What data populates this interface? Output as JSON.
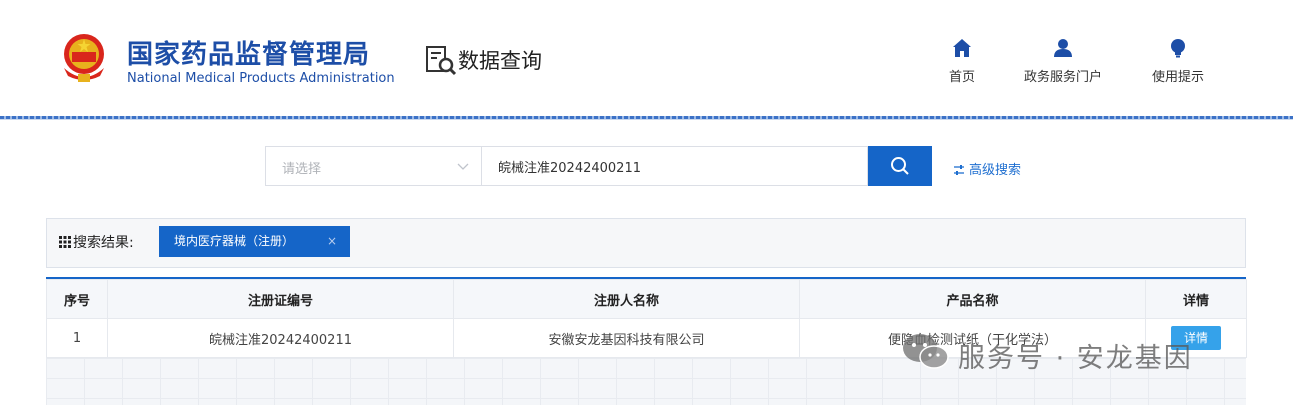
{
  "header": {
    "agency_cn": "国家药品监督管理局",
    "agency_en": "National Medical Products Administration",
    "section": "数据查询",
    "nav": [
      {
        "label": "首页",
        "icon": "home-icon"
      },
      {
        "label": "政务服务门户",
        "icon": "user-icon"
      },
      {
        "label": "使用提示",
        "icon": "lightbulb-icon"
      }
    ]
  },
  "search": {
    "select_placeholder": "请选择",
    "query": "皖械注准20242400211",
    "advanced_label": "高级搜索"
  },
  "results": {
    "label": "搜索结果:",
    "tag": "境内医疗器械（注册）",
    "tag_close": "×"
  },
  "table": {
    "columns": [
      "序号",
      "注册证编号",
      "注册人名称",
      "产品名称",
      "详情"
    ],
    "rows": [
      {
        "index": "1",
        "reg_no": "皖械注准20242400211",
        "registrant": "安徽安龙基因科技有限公司",
        "product": "便隐血检测试纸（干化学法）",
        "detail": "详情"
      }
    ]
  },
  "watermark": {
    "text": "服务号 · 安龙基因",
    "icon": "wechat-icon"
  },
  "colors": {
    "brand_blue": "#1d4ea7",
    "button_blue": "#1565c8",
    "detail_blue": "#35a2ea"
  }
}
